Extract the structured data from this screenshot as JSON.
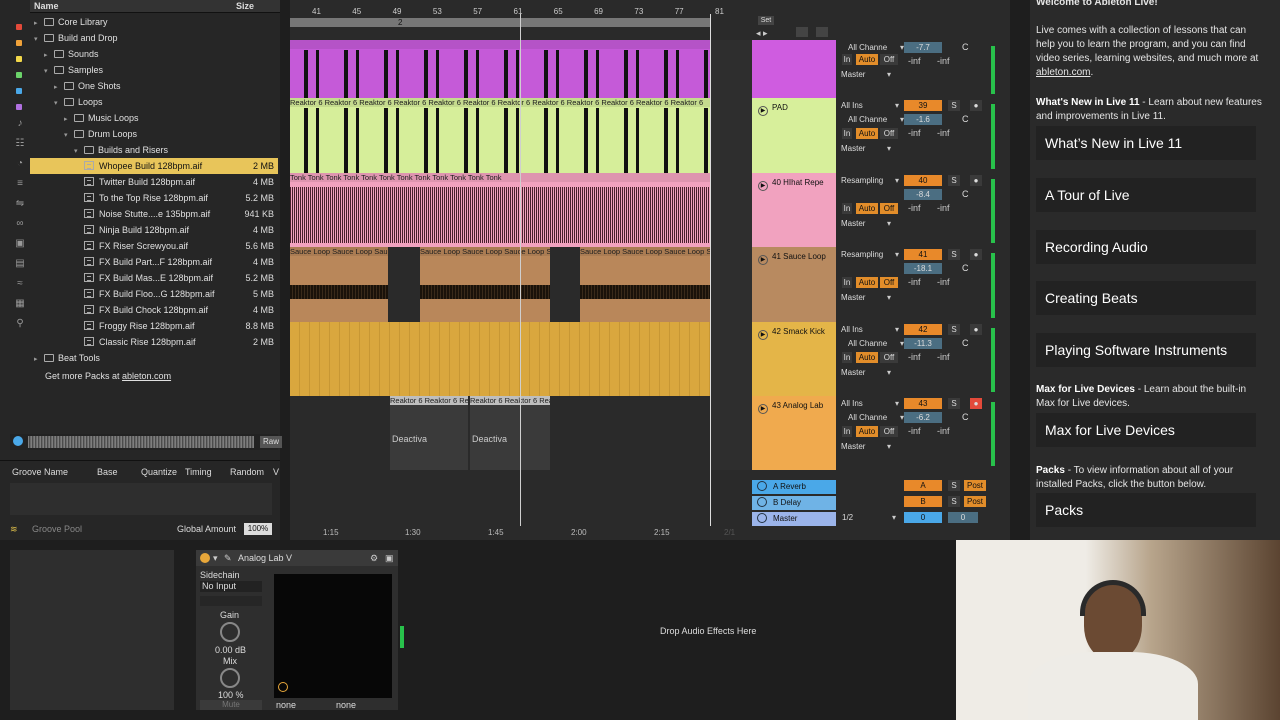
{
  "browser": {
    "col_name": "Name",
    "col_size": "Size",
    "rows": [
      {
        "label": "Core Library",
        "size": "",
        "kind": "folder",
        "indent": 0,
        "open": false
      },
      {
        "label": "Build and Drop",
        "size": "",
        "kind": "folder",
        "indent": 0,
        "open": true
      },
      {
        "label": "Sounds",
        "size": "",
        "kind": "folder",
        "indent": 1,
        "open": false
      },
      {
        "label": "Samples",
        "size": "",
        "kind": "folder",
        "indent": 1,
        "open": true
      },
      {
        "label": "One Shots",
        "size": "",
        "kind": "folder",
        "indent": 2,
        "open": false
      },
      {
        "label": "Loops",
        "size": "",
        "kind": "folder",
        "indent": 2,
        "open": true
      },
      {
        "label": "Music Loops",
        "size": "",
        "kind": "folder",
        "indent": 3,
        "open": false
      },
      {
        "label": "Drum Loops",
        "size": "",
        "kind": "folder",
        "indent": 3,
        "open": true
      },
      {
        "label": "Builds and Risers",
        "size": "",
        "kind": "folder",
        "indent": 4,
        "open": true
      },
      {
        "label": "Whopee Build 128bpm.aif",
        "size": "2 MB",
        "kind": "file",
        "indent": 5,
        "selected": true
      },
      {
        "label": "Twitter Build 128bpm.aif",
        "size": "4 MB",
        "kind": "file",
        "indent": 5
      },
      {
        "label": "To the Top Rise 128bpm.aif",
        "size": "5.2 MB",
        "kind": "file",
        "indent": 5
      },
      {
        "label": "Noise Stutte....e 135bpm.aif",
        "size": "941 KB",
        "kind": "file",
        "indent": 5
      },
      {
        "label": "Ninja Build 128bpm.aif",
        "size": "4 MB",
        "kind": "file",
        "indent": 5
      },
      {
        "label": "FX Riser Screwyou.aif",
        "size": "5.6 MB",
        "kind": "file",
        "indent": 5
      },
      {
        "label": "FX Build Part...F 128bpm.aif",
        "size": "4 MB",
        "kind": "file",
        "indent": 5
      },
      {
        "label": "FX Build Mas...E 128bpm.aif",
        "size": "5.2 MB",
        "kind": "file",
        "indent": 5
      },
      {
        "label": "FX Build Floo...G 128bpm.aif",
        "size": "5 MB",
        "kind": "file",
        "indent": 5
      },
      {
        "label": "FX Build Chock 128bpm.aif",
        "size": "4 MB",
        "kind": "file",
        "indent": 5
      },
      {
        "label": "Froggy Rise 128bpm.aif",
        "size": "8.8 MB",
        "kind": "file",
        "indent": 5
      },
      {
        "label": "Classic Rise 128bpm.aif",
        "size": "2 MB",
        "kind": "file",
        "indent": 5
      },
      {
        "label": "Beat Tools",
        "size": "",
        "kind": "folder",
        "indent": 0,
        "open": false
      }
    ],
    "more_packs": "Get more Packs at ",
    "more_packs_link": "ableton.com",
    "preview_raw": "Raw"
  },
  "groove": {
    "headers": [
      "Groove Name",
      "Base",
      "Quantize",
      "Timing",
      "Random",
      "V"
    ],
    "pool_label": "Groove Pool",
    "amount_label": "Global Amount",
    "amount_value": "100%"
  },
  "ruler": {
    "bars": [
      "41",
      "45",
      "49",
      "53",
      "57",
      "61",
      "65",
      "69",
      "73",
      "77",
      "81"
    ],
    "marker": "2",
    "set_label": "Set"
  },
  "timeline": {
    "times": [
      "1:15",
      "1:30",
      "1:45",
      "2:00",
      "2:15"
    ],
    "sig": "2/1"
  },
  "tracks": [
    {
      "name": "",
      "color": "#c55ad8",
      "slot_color": "#cf5ce0",
      "route_top": "All Channe",
      "route_mid": "",
      "vol": "-7.7",
      "num": "",
      "pan": "C",
      "clip_prefix": ""
    },
    {
      "name": "PAD",
      "color": "#d6ee9a",
      "slot_color": "#d7ef9b",
      "route_top": "All Ins",
      "route_mid": "All Channe",
      "vol": "-1.6",
      "num": "39",
      "pan": "C",
      "clip_prefix": "Reaktor 6"
    },
    {
      "name": "40 HIhat Repe",
      "color": "#f1a2be",
      "slot_color": "#f1a2bf",
      "route_top": "Resampling",
      "route_mid": "",
      "vol": "-8.4",
      "num": "40",
      "pan": "C",
      "clip_prefix": "Tonk"
    },
    {
      "name": "41 Sauce Loop",
      "color": "#b9875a",
      "slot_color": "#b88a60",
      "route_top": "Resampling",
      "route_mid": "",
      "vol": "-18.1",
      "num": "41",
      "pan": "C",
      "clip_prefix": "Sauce Loop"
    },
    {
      "name": "42 Smack Kick",
      "color": "#e4b548",
      "slot_color": "#e4b548",
      "route_top": "All Ins",
      "route_mid": "All Channe",
      "vol": "-11.3",
      "num": "42",
      "pan": "C",
      "clip_prefix": ""
    },
    {
      "name": "43 Analog Lab",
      "color": "#f0aa4e",
      "slot_color": "#f0aa4e",
      "route_top": "All Ins",
      "route_mid": "All Channe",
      "vol": "-6.2",
      "num": "43",
      "pan": "C",
      "clip_prefix": "Reaktor 6"
    }
  ],
  "mixer": {
    "in": "In",
    "auto": "Auto",
    "off": "Off",
    "master": "Master",
    "inf": "-inf",
    "s": "S",
    "cue": "Post"
  },
  "clip_extra": {
    "deact": "Deactiva"
  },
  "returns": [
    {
      "name": "A Reverb",
      "letter": "A",
      "vol": "",
      "send": "Post"
    },
    {
      "name": "B Delay",
      "letter": "B",
      "vol": "",
      "send": "Post"
    },
    {
      "name": "Master",
      "letter": "0",
      "vol": "0",
      "send": "1/2"
    }
  ],
  "help": {
    "title": "Welcome to Ableton Live!",
    "intro": "Live comes with a collection of lessons that can help you to learn the program, and you can find video series, learning websites, and much more at ",
    "intro_link": "ableton.com",
    "whats_new_bold": "What's New in Live 11",
    "whats_new_text": " - Learn about new features and improvements in Live 11.",
    "lessons": [
      "What’s New in Live 11",
      "A Tour of Live",
      "Recording Audio",
      "Creating Beats",
      "Playing Software Instruments"
    ],
    "max_bold": "Max for Live Devices",
    "max_text": " - Learn about the built-in Max for Live devices.",
    "max_button": "Max for Live Devices",
    "packs_bold": "Packs",
    "packs_text": " - To view information about all of your installed Packs, click the button below.",
    "packs_button": "Packs"
  },
  "device": {
    "title": "Analog Lab V",
    "sidechain": "Sidechain",
    "input": "No Input",
    "gain_label": "Gain",
    "gain_value": "0.00 dB",
    "mix_label": "Mix",
    "mix_value": "100 %",
    "mute": "Mute",
    "sel1": "none",
    "sel2": "none",
    "drop_text": "Drop Audio Effects Here"
  }
}
